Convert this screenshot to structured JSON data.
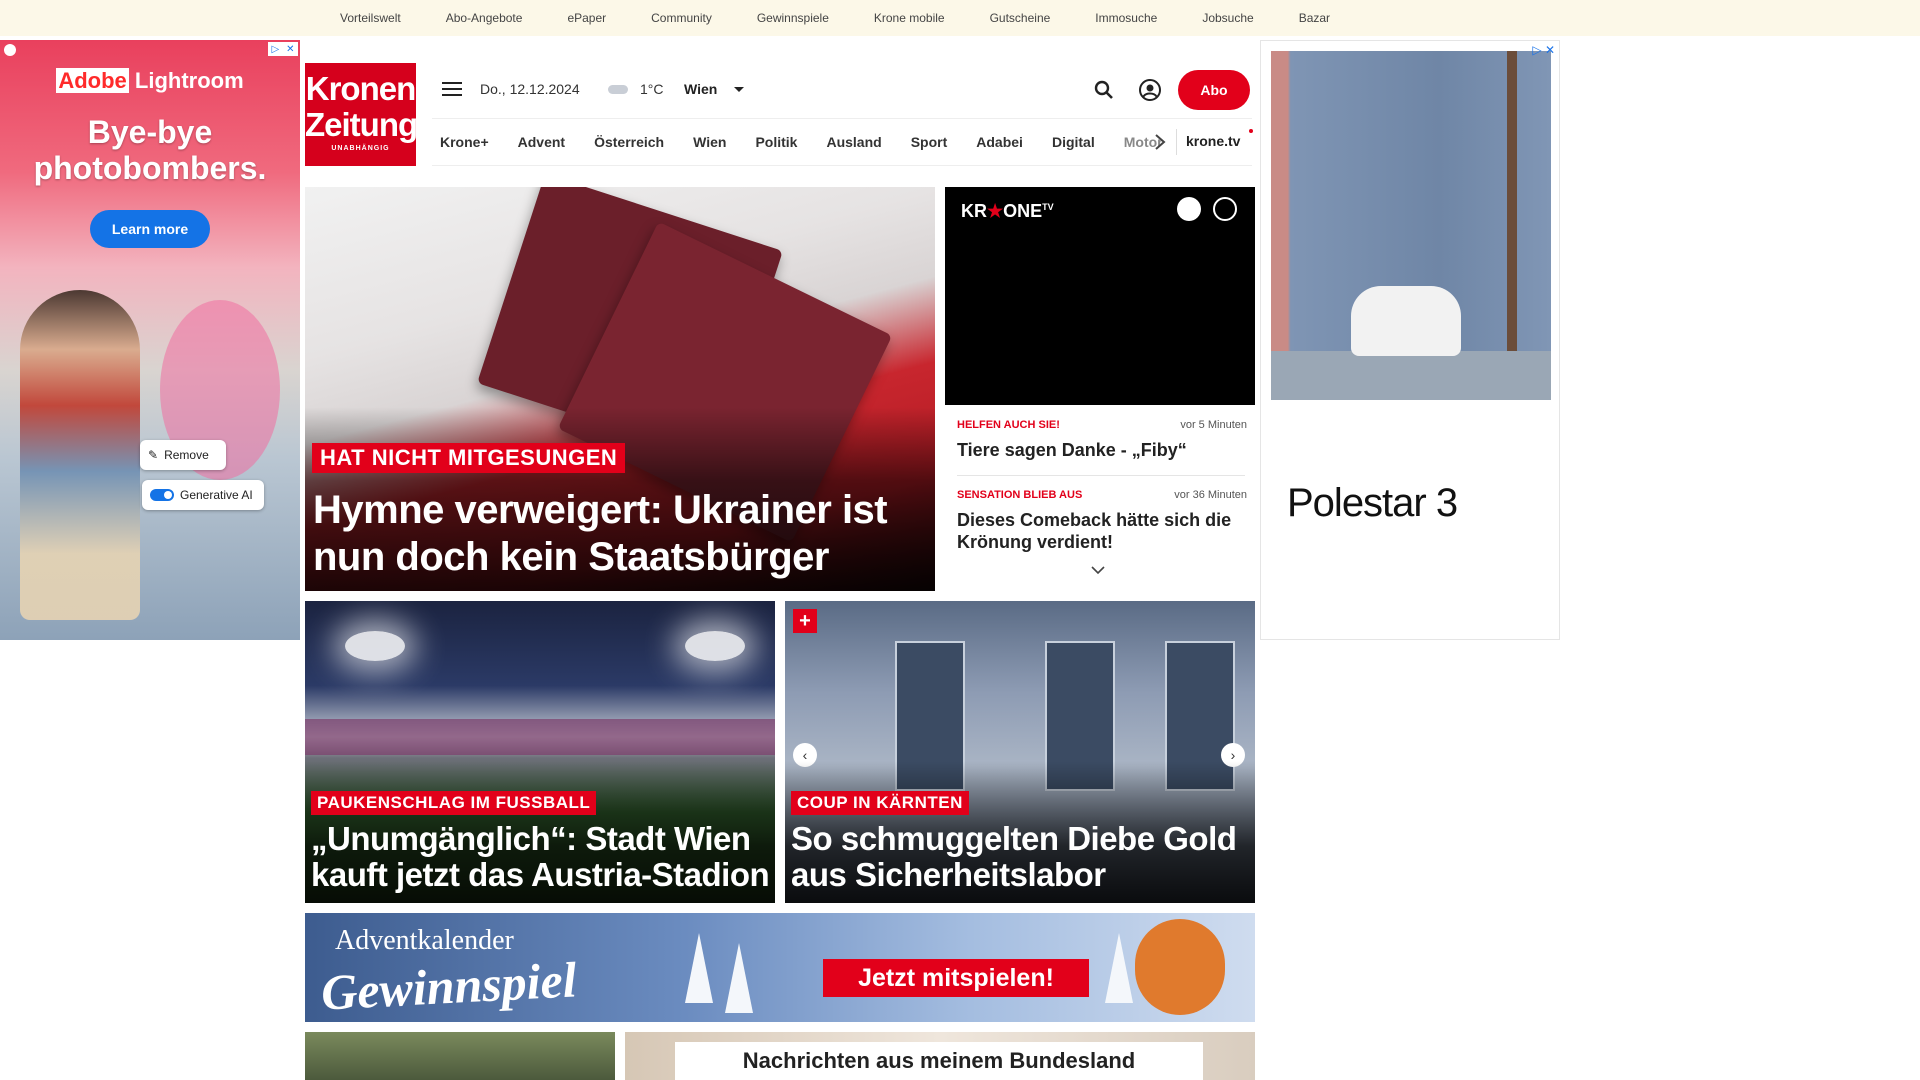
{
  "topbar": {
    "links": [
      "Vorteilswelt",
      "Abo-Angebote",
      "ePaper",
      "Community",
      "Gewinnspiele",
      "Krone mobile",
      "Gutscheine",
      "Immosuche",
      "Jobsuche",
      "Bazar"
    ]
  },
  "logo": {
    "line1": "Kronen",
    "line2": "Zeitung",
    "line3": "UNABHÄNGIG"
  },
  "header": {
    "date": "Do., 12.12.2024",
    "temperature": "1°C",
    "city": "Wien",
    "abo_label": "Abo"
  },
  "nav": {
    "items": [
      "Krone+",
      "Advent",
      "Österreich",
      "Wien",
      "Politik",
      "Ausland",
      "Sport",
      "Adabei",
      "Digital",
      "Motor"
    ],
    "kronetv": "krone.tv"
  },
  "hero": {
    "kicker": "HAT NICHT MITGESUNGEN",
    "title": "Hymne verweigert: Ukrainer ist nun doch kein Staatsbürger"
  },
  "video": {
    "brand_left": "KR",
    "brand_right": "ONE",
    "brand_sup": "TV"
  },
  "side_list": [
    {
      "kicker": "HELFEN AUCH SIE!",
      "time": "vor 5 Minuten",
      "title": "Tiere sagen Danke - „Fiby“"
    },
    {
      "kicker": "SENSATION BLIEB AUS",
      "time": "vor 36 Minuten",
      "title": "Dieses Comeback hätte sich die Krönung verdient!"
    }
  ],
  "tiles": [
    {
      "kicker": "PAUKENSCHLAG IM FUSSBALL",
      "title": "„Unumgänglich“: Stadt Wien kauft jetzt das Austria-Stadion"
    },
    {
      "kicker": "COUP IN KÄRNTEN",
      "title": "So schmuggelten Diebe Gold aus Sicherheitslabor",
      "badge": "+"
    }
  ],
  "banner": {
    "line1": "Adventkalender",
    "line2": "Gewinnspiel",
    "cta": "Jetzt mitspielen!"
  },
  "bottom": {
    "headline": "Nachrichten aus meinem Bundesland"
  },
  "ad_left": {
    "brand_a": "Adobe",
    "brand_b": "Lightroom",
    "headline": "Bye-bye photobombers.",
    "cta": "Learn more",
    "remove": "Remove",
    "genai": "Generative AI"
  },
  "ad_right": {
    "brand": "Polestar 3"
  },
  "colors": {
    "brand_red": "#e2001a",
    "topbar_bg": "#fcf8e8"
  }
}
